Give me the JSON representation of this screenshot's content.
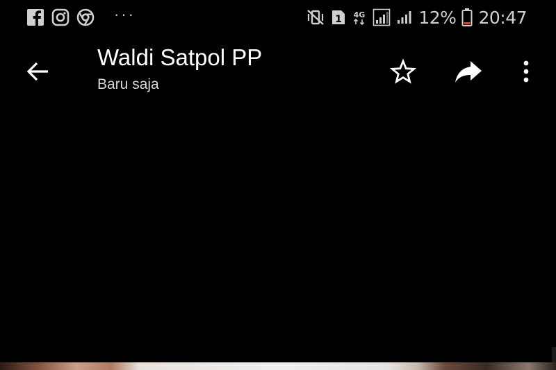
{
  "status_bar": {
    "left_icons": [
      "facebook-icon",
      "instagram-icon",
      "chrome-icon"
    ],
    "more_notifications": "···",
    "right_icons": [
      "mute-vibrate-icon",
      "sim-1-icon",
      "4g-network-icon",
      "signal-sim1-icon",
      "signal-sim2-icon",
      "battery-icon"
    ],
    "network_type": "4G",
    "sim_slot": "1",
    "battery_percent": "12%",
    "time": "20:47"
  },
  "header": {
    "back_icon": "arrow-left-icon",
    "title": "Waldi Satpol PP",
    "subtitle": "Baru saja",
    "actions": [
      "star-icon",
      "share-icon",
      "more-vertical-icon"
    ]
  },
  "colors": {
    "background": "#000000",
    "text_primary": "#ffffff",
    "text_secondary": "#d8d8d8",
    "status_icons": "#d0d0d0",
    "battery_low": "#e53935"
  }
}
